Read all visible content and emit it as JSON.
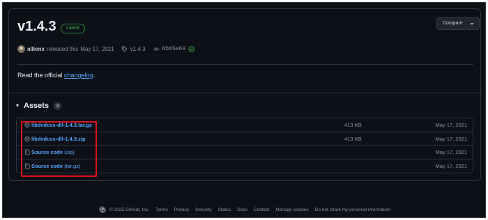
{
  "release": {
    "title": "v1.4.3",
    "badge": "Latest",
    "compare_label": "Compare",
    "author": "allienx",
    "released_text": "released this",
    "date": "May 17, 2021",
    "tag": "v1.4.3",
    "commit": "8b05e69",
    "body_prefix": "Read the official ",
    "body_link": "changelog",
    "body_suffix": "."
  },
  "assets": {
    "heading": "Assets",
    "count": "4",
    "items": [
      {
        "icon": "package-icon",
        "name": "libdvdcss-dll-1.4.3.tar.gz",
        "ext": "",
        "size": "413 KB",
        "date": "May 17, 2021"
      },
      {
        "icon": "package-icon",
        "name": "libdvdcss-dll-1.4.3.zip",
        "ext": "",
        "size": "413 KB",
        "date": "May 17, 2021"
      },
      {
        "icon": "file-zip-icon",
        "name": "Source code",
        "ext": " (zip)",
        "size": "",
        "date": "May 17, 2021"
      },
      {
        "icon": "file-zip-icon",
        "name": "Source code",
        "ext": " (tar.gz)",
        "size": "",
        "date": "May 17, 2021"
      }
    ]
  },
  "footer": {
    "copyright": "© 2025 GitHub, Inc.",
    "links": [
      "Terms",
      "Privacy",
      "Security",
      "Status",
      "Docs",
      "Contact",
      "Manage cookies",
      "Do not share my personal information"
    ]
  },
  "colors": {
    "background": "#0d1117",
    "link": "#58a6ff",
    "badge_green": "#3fb950",
    "highlight_red": "#e0101a"
  }
}
